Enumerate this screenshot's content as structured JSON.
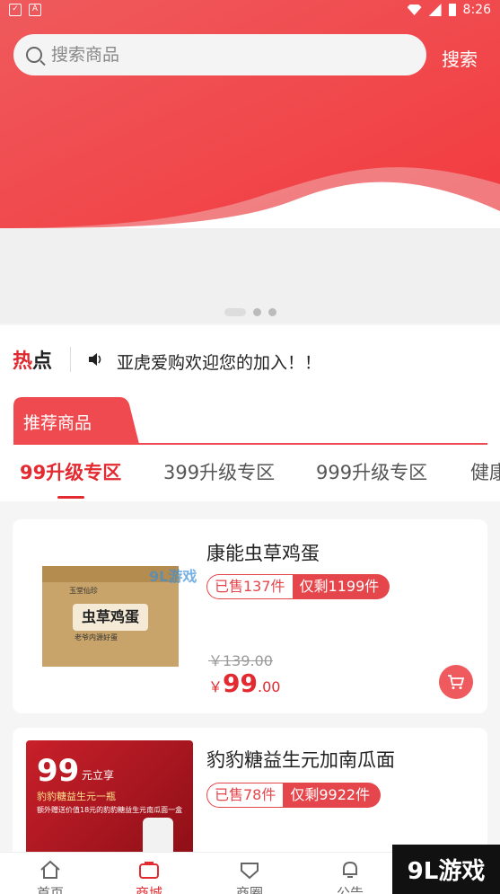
{
  "status_bar": {
    "time": "8:26"
  },
  "search": {
    "placeholder": "搜索商品",
    "button_label": "搜索"
  },
  "news": {
    "hot_label_1": "热",
    "hot_label_2": "点",
    "text": "亚虎爱购欢迎您的加入！！"
  },
  "recommend": {
    "tab_label": "推荐商品",
    "categories": [
      "99升级专区",
      "399升级专区",
      "999升级专区",
      "健康"
    ],
    "active_category": 0
  },
  "products": [
    {
      "title": "康能虫草鸡蛋",
      "sold": "已售137件",
      "remaining": "仅剩1199件",
      "old_price": "￥139.00",
      "price_currency": "￥",
      "price_int": "99",
      "price_dec": ".00",
      "image_brand": "玉堂仙珍",
      "image_label": "虫草鸡蛋",
      "image_sub": "老爷内源好蛋"
    },
    {
      "title": "豹豹糖益生元加南瓜面",
      "sold": "已售78件",
      "remaining": "仅剩9922件",
      "image_big": "99",
      "image_small": "元立享",
      "image_line2": "豹豹糖益生元一瓶",
      "image_line3": "额外赠送价值18元的豹豹糖益生元南瓜面一盒"
    }
  ],
  "bottom_nav": [
    {
      "label": "首页",
      "icon": "home-icon"
    },
    {
      "label": "商城",
      "icon": "mall-icon"
    },
    {
      "label": "商圈",
      "icon": "circle-icon"
    },
    {
      "label": "公告",
      "icon": "notice-icon"
    }
  ],
  "watermark": {
    "text": "9L游戏",
    "small": "9L游戏"
  },
  "colors": {
    "brand_red": "#e22a30",
    "hero_red": "#ef5054"
  }
}
